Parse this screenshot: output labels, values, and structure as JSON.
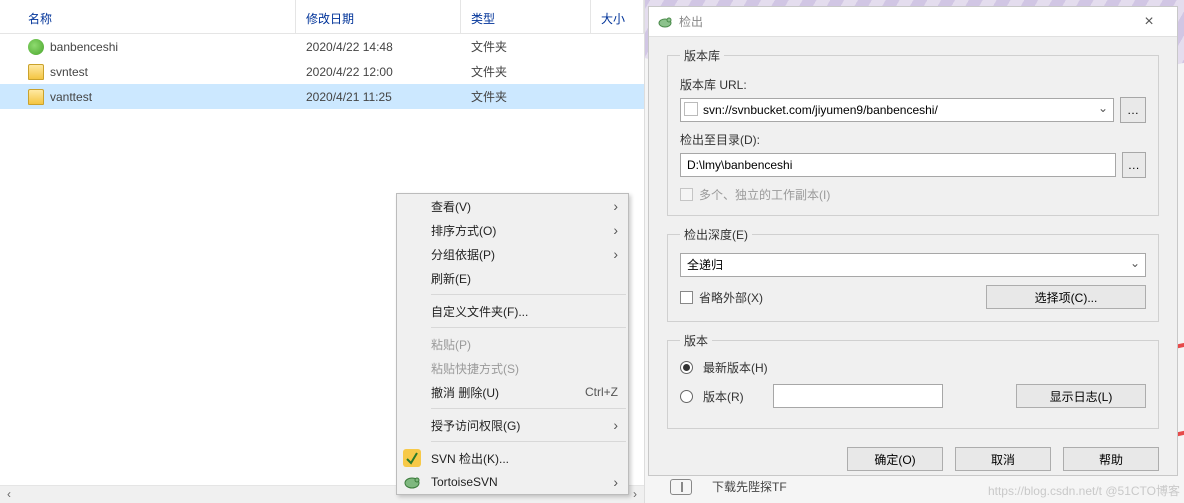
{
  "columns": {
    "name": "名称",
    "date": "修改日期",
    "type": "类型",
    "size": "大小"
  },
  "rows": [
    {
      "icon": "green",
      "name": "banbenceshi",
      "date": "2020/4/22 14:48",
      "type": "文件夹",
      "selected": false
    },
    {
      "icon": "folder",
      "name": "svntest",
      "date": "2020/4/22 12:00",
      "type": "文件夹",
      "selected": false
    },
    {
      "icon": "folder",
      "name": "vanttest",
      "date": "2020/4/21 11:25",
      "type": "文件夹",
      "selected": true
    }
  ],
  "contextmenu": {
    "view": "查看(V)",
    "sort": "排序方式(O)",
    "group": "分组依据(P)",
    "refresh": "刷新(E)",
    "customize": "自定义文件夹(F)...",
    "paste": "粘贴(P)",
    "paste_shortcut": "粘贴快捷方式(S)",
    "undo": "撤消 删除(U)",
    "undo_kb": "Ctrl+Z",
    "grant": "授予访问权限(G)",
    "svn_checkout": "SVN 检出(K)...",
    "tortoise": "TortoiseSVN"
  },
  "dialog": {
    "title": "检出",
    "repo_group": "版本库",
    "repo_url_label": "版本库 URL:",
    "repo_url_value": "svn://svnbucket.com/jiyumen9/banbenceshi/",
    "target_label": "检出至目录(D):",
    "target_value": "D:\\lmy\\banbenceshi",
    "multi_wc": "多个、独立的工作副本(I)",
    "depth_group": "检出深度(E)",
    "depth_value": "全递归",
    "omit_ext": "省略外部(X)",
    "choose_items": "选择项(C)...",
    "rev_group": "版本",
    "rev_head": "最新版本(H)",
    "rev_specific": "版本(R)",
    "show_log": "显示日志(L)",
    "ok": "确定(O)",
    "cancel": "取消",
    "help": "帮助"
  },
  "under_dialog": "下载先陛探TF",
  "watermark": "https://blog.csdn.net/t   @51CTO博客"
}
